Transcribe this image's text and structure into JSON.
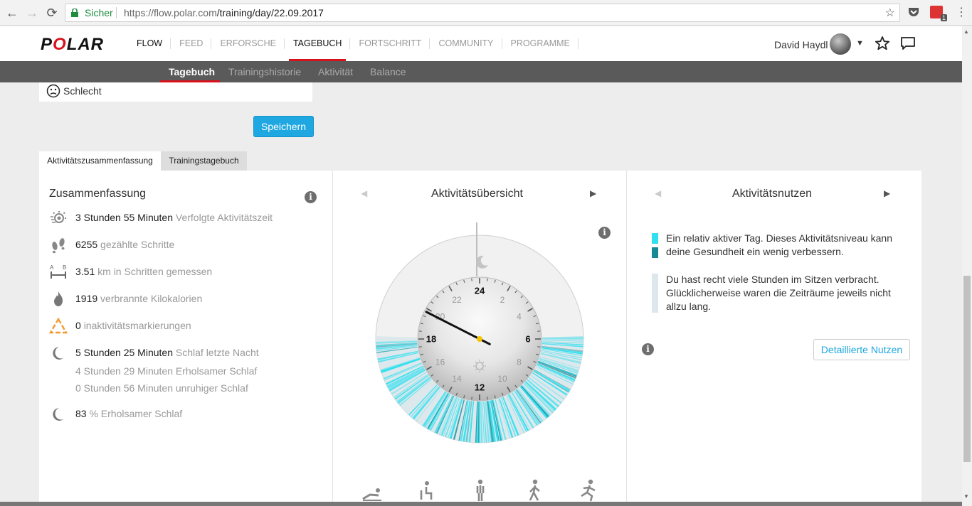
{
  "browser": {
    "secure_label": "Sicher",
    "url_host": "https://flow.polar.com",
    "url_path": "/training/day/22.09.2017",
    "ext_badge": "1"
  },
  "header": {
    "logo_pre": "P",
    "logo_o": "O",
    "logo_post": "LAR",
    "nav": [
      "FLOW",
      "FEED",
      "ERFORSCHE",
      "TAGEBUCH",
      "FORTSCHRITT",
      "COMMUNITY",
      "PROGRAMME"
    ],
    "active_nav": "TAGEBUCH",
    "user_name": "David Haydl"
  },
  "subnav": [
    "Tagebuch",
    "Trainingshistorie",
    "Aktivität",
    "Balance"
  ],
  "mood": {
    "label": "Schlecht"
  },
  "save_label": "Speichern",
  "tabs": [
    "Aktivitätszusammenfassung",
    "Trainingstagebuch"
  ],
  "summary": {
    "title": "Zusammenfassung",
    "rows": [
      {
        "icon": "activity-time-icon",
        "value": "3 Stunden 55 Minuten",
        "label": "Verfolgte Aktivitätszeit"
      },
      {
        "icon": "footsteps-icon",
        "value": "6255",
        "label": "gezählte Schritte"
      },
      {
        "icon": "distance-icon",
        "value": "3.51",
        "label": "km in Schritten gemessen"
      },
      {
        "icon": "flame-icon",
        "value": "1919",
        "label": "verbrannte Kilokalorien"
      },
      {
        "icon": "inactivity-icon",
        "value": "0",
        "label": "inaktivitätsmarkierungen"
      },
      {
        "icon": "moon-icon",
        "value": "5 Stunden 25 Minuten",
        "label": "Schlaf letzte Nacht"
      }
    ],
    "sleep_sub": [
      "4 Stunden 29 Minuten Erholsamer Schlaf",
      "0 Stunden 56 Minuten unruhiger Schlaf"
    ],
    "restful": {
      "value": "83",
      "label": "% Erholsamer Schlaf"
    },
    "distance_letters": [
      "A",
      "B"
    ]
  },
  "overview": {
    "title": "Aktivitätsübersicht",
    "hours_major": [
      "24",
      "6",
      "12",
      "18"
    ],
    "hours_minor": [
      "2",
      "4",
      "8",
      "10",
      "14",
      "16",
      "20",
      "22"
    ],
    "clock_hour": 19.8
  },
  "benefit": {
    "title": "Aktivitätsnutzen",
    "text1": "Ein relativ aktiver Tag. Dieses Aktivitätsniveau kann deine Gesundheit ein wenig verbessern.",
    "text2": "Du hast recht viele Stunden im Sitzen verbracht. Glücklicherweise waren die Zeiträume jeweils nicht allzu lang.",
    "detail_label": "Detaillierte Nutzen"
  },
  "colors": {
    "accent": "#1ea7e1",
    "polar_red": "#d8121c",
    "active_light": "#2ee0f0",
    "active_dark": "#138a96",
    "sitting": "#dde8ec"
  }
}
